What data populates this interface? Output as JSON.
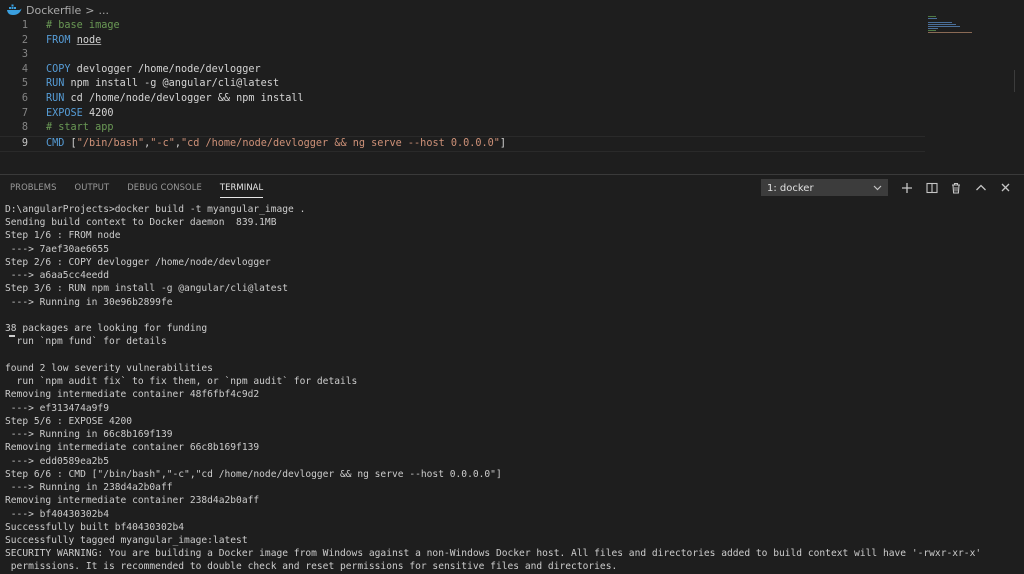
{
  "breadcrumb": {
    "file": "Dockerfile",
    "separator": ">",
    "more": "..."
  },
  "editor": {
    "lines": [
      {
        "n": "1",
        "tokens": [
          {
            "t": "# base image",
            "c": "comment"
          }
        ]
      },
      {
        "n": "2",
        "tokens": [
          {
            "t": "FROM",
            "c": "kw"
          },
          {
            "t": " ",
            "c": "plain"
          },
          {
            "t": "node",
            "c": "under"
          }
        ]
      },
      {
        "n": "3",
        "tokens": []
      },
      {
        "n": "4",
        "tokens": [
          {
            "t": "COPY",
            "c": "kw"
          },
          {
            "t": " devlogger /home/node/devlogger",
            "c": "plain"
          }
        ]
      },
      {
        "n": "5",
        "tokens": [
          {
            "t": "RUN",
            "c": "kw"
          },
          {
            "t": " npm install -g @angular/cli@latest",
            "c": "plain"
          }
        ]
      },
      {
        "n": "6",
        "tokens": [
          {
            "t": "RUN",
            "c": "kw"
          },
          {
            "t": " cd /home/node/devlogger && npm install",
            "c": "plain"
          }
        ]
      },
      {
        "n": "7",
        "tokens": [
          {
            "t": "EXPOSE",
            "c": "kw"
          },
          {
            "t": " 4200",
            "c": "plain"
          }
        ]
      },
      {
        "n": "8",
        "tokens": [
          {
            "t": "# start app",
            "c": "comment"
          }
        ]
      },
      {
        "n": "9",
        "tokens": [
          {
            "t": "CMD",
            "c": "kw"
          },
          {
            "t": " [",
            "c": "plain"
          },
          {
            "t": "\"/bin/bash\"",
            "c": "str"
          },
          {
            "t": ",",
            "c": "plain"
          },
          {
            "t": "\"-c\"",
            "c": "str"
          },
          {
            "t": ",",
            "c": "plain"
          },
          {
            "t": "\"cd /home/node/devlogger && ng serve --host 0.0.0.0\"",
            "c": "str"
          },
          {
            "t": "]",
            "c": "plain"
          }
        ]
      }
    ],
    "active_line": 8
  },
  "panel": {
    "tabs": [
      {
        "id": "problems",
        "label": "PROBLEMS"
      },
      {
        "id": "output",
        "label": "OUTPUT"
      },
      {
        "id": "debug",
        "label": "DEBUG CONSOLE"
      },
      {
        "id": "terminal",
        "label": "TERMINAL"
      }
    ],
    "active_tab": "terminal",
    "terminal_select": "1: docker",
    "buttons": [
      "add-terminal",
      "split-terminal",
      "kill-terminal",
      "maximize-panel",
      "close-panel"
    ]
  },
  "terminal": {
    "lines": [
      "D:\\angularProjects>docker build -t myangular_image .",
      "Sending build context to Docker daemon  839.1MB",
      "Step 1/6 : FROM node",
      " ---> 7aef30ae6655",
      "Step 2/6 : COPY devlogger /home/node/devlogger",
      " ---> a6aa5cc4eedd",
      "Step 3/6 : RUN npm install -g @angular/cli@latest",
      " ---> Running in 30e96b2899fe",
      "",
      "38 packages are looking for funding",
      "  run `npm fund` for details",
      "",
      "found 2 low severity vulnerabilities",
      "  run `npm audit fix` to fix them, or `npm audit` for details",
      "Removing intermediate container 48f6fbf4c9d2",
      " ---> ef313474a9f9",
      "Step 5/6 : EXPOSE 4200",
      " ---> Running in 66c8b169f139",
      "Removing intermediate container 66c8b169f139",
      " ---> edd0589ea2b5",
      "Step 6/6 : CMD [\"/bin/bash\",\"-c\",\"cd /home/node/devlogger && ng serve --host 0.0.0.0\"]",
      " ---> Running in 238d4a2b0aff",
      "Removing intermediate container 238d4a2b0aff",
      " ---> bf40430302b4",
      "Successfully built bf40430302b4",
      "Successfully tagged myangular_image:latest",
      "SECURITY WARNING: You are building a Docker image from Windows against a non-Windows Docker host. All files and directories added to build context will have '-rwxr-xr-x'",
      " permissions. It is recommended to double check and reset permissions for sensitive files and directories."
    ]
  },
  "colors": {
    "background": "#1e1e1e",
    "comment": "#6a9955",
    "keyword": "#569cd6",
    "string": "#ce9178",
    "text": "#d4d4d4",
    "terminal_text": "#cccccc"
  }
}
